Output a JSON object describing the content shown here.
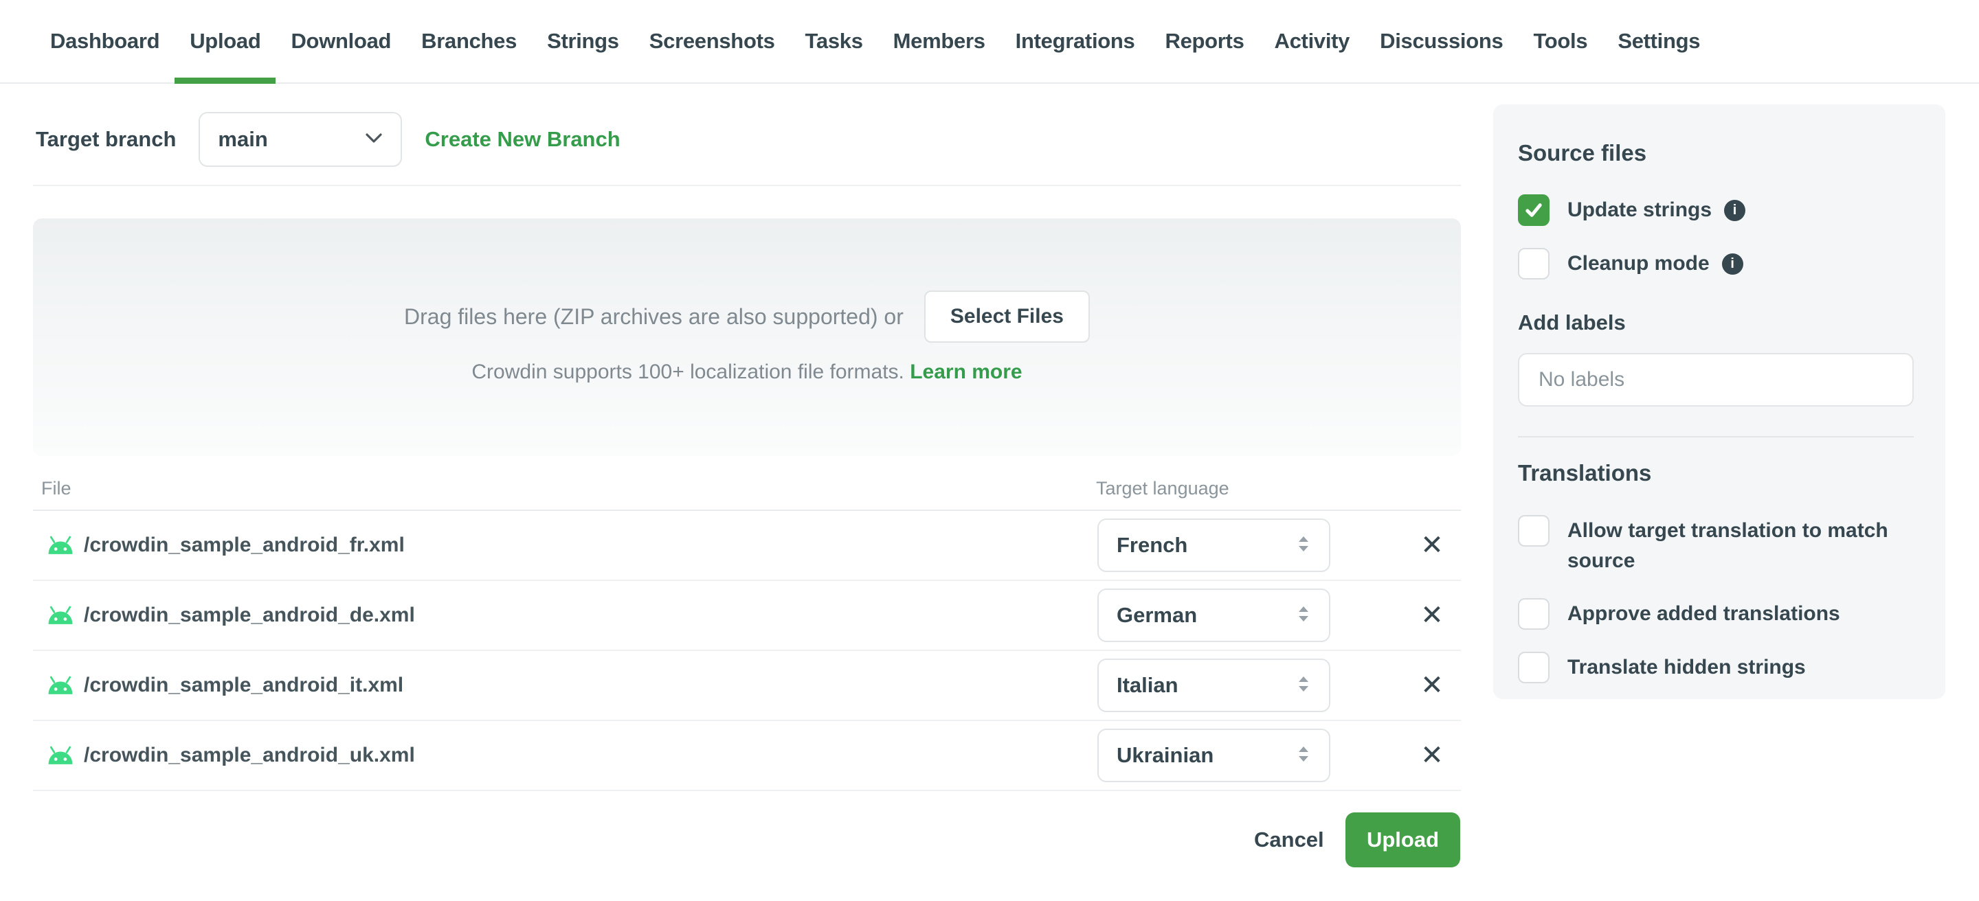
{
  "nav": {
    "items": [
      "Dashboard",
      "Upload",
      "Download",
      "Branches",
      "Strings",
      "Screenshots",
      "Tasks",
      "Members",
      "Integrations",
      "Reports",
      "Activity",
      "Discussions",
      "Tools",
      "Settings"
    ],
    "active_tab": "Upload"
  },
  "branch": {
    "label": "Target branch",
    "selected_branch": "main",
    "create_new_branch": "Create New Branch"
  },
  "dropzone": {
    "drag_text": "Drag files here (ZIP archives are also supported) or",
    "select_files_button": "Select Files",
    "supports_text": "Crowdin supports 100+ localization file formats.",
    "learn_more_link": "Learn more"
  },
  "files_table": {
    "headers": {
      "file": "File",
      "target_language": "Target language"
    },
    "rows": [
      {
        "file": "/crowdin_sample_android_fr.xml",
        "language": "French"
      },
      {
        "file": "/crowdin_sample_android_de.xml",
        "language": "German"
      },
      {
        "file": "/crowdin_sample_android_it.xml",
        "language": "Italian"
      },
      {
        "file": "/crowdin_sample_android_uk.xml",
        "language": "Ukrainian"
      }
    ]
  },
  "actions": {
    "cancel_button": "Cancel",
    "upload_button": "Upload"
  },
  "sidebar": {
    "source_files": {
      "title": "Source files",
      "options": [
        {
          "label": "Update strings",
          "checked": true,
          "has_info": true
        },
        {
          "label": "Cleanup mode",
          "checked": false,
          "has_info": true
        }
      ]
    },
    "add_labels": {
      "title": "Add labels",
      "placeholder": "No labels"
    },
    "translations": {
      "title": "Translations",
      "options": [
        {
          "label": "Allow target translation to match source",
          "checked": false
        },
        {
          "label": "Approve added translations",
          "checked": false
        },
        {
          "label": "Translate hidden strings",
          "checked": false
        }
      ]
    }
  },
  "icons": {
    "remove": "✕",
    "info": "i"
  },
  "colors": {
    "accent_green": "#43a047",
    "link_green": "#359c4b",
    "android_green": "#3ddc84"
  }
}
